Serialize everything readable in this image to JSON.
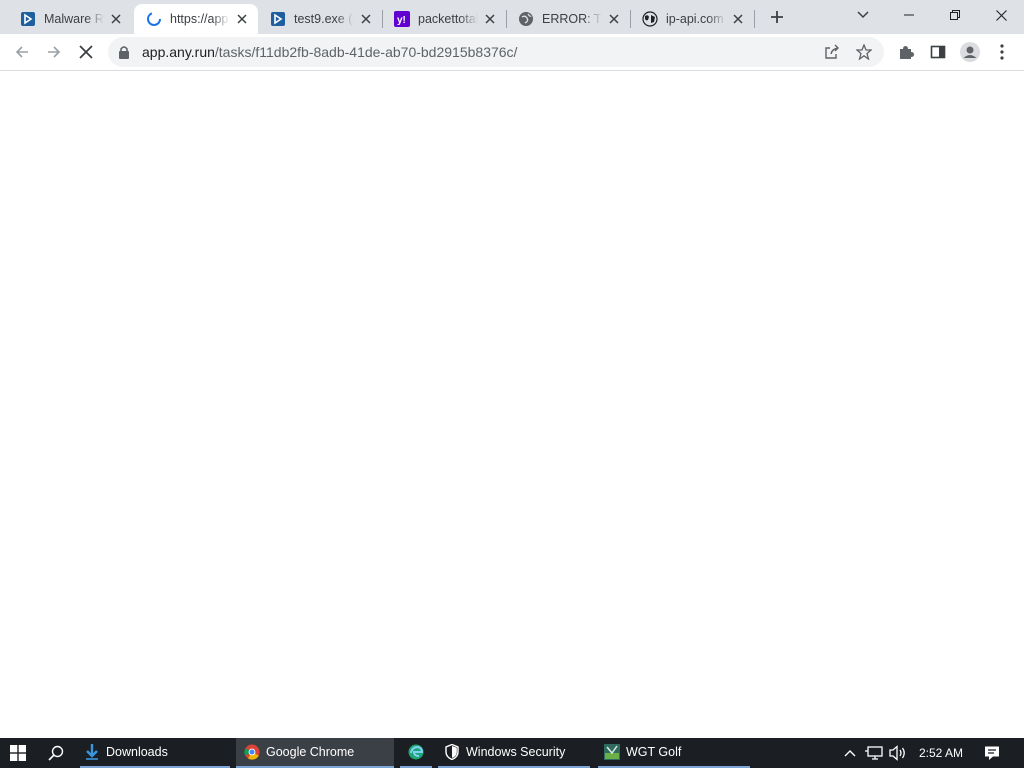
{
  "browser": {
    "tabs": [
      {
        "title": "Malware Re",
        "favicon": "anyrun-icon",
        "active": false
      },
      {
        "title": "https://app",
        "favicon": "loading-spinner-icon",
        "active": true
      },
      {
        "title": "test9.exe (M",
        "favicon": "anyrun-icon",
        "active": false
      },
      {
        "title": "packettotal",
        "favicon": "yahoo-icon",
        "active": false
      },
      {
        "title": "ERROR: Th",
        "favicon": "globe-icon",
        "active": false
      },
      {
        "title": "ip-api.com",
        "favicon": "ip-api-icon",
        "active": false
      }
    ],
    "url": {
      "host": "app.any.run",
      "path": "/tasks/f11db2fb-8adb-41de-ab70-bd2915b8376c/"
    },
    "loading": true
  },
  "taskbar": {
    "items": [
      {
        "label": "Downloads",
        "icon": "download-arrow-icon"
      },
      {
        "label": "Google Chrome",
        "icon": "chrome-icon"
      },
      {
        "label": "",
        "icon": "edge-icon"
      },
      {
        "label": "Windows Security",
        "icon": "shield-icon"
      },
      {
        "label": "WGT Golf",
        "icon": "wgt-golf-icon"
      }
    ],
    "clock": "2:52 AM"
  },
  "colors": {
    "tabstrip": "#dee1e6",
    "taskbar": "#1b1f23",
    "accent": "#1a73e8"
  }
}
